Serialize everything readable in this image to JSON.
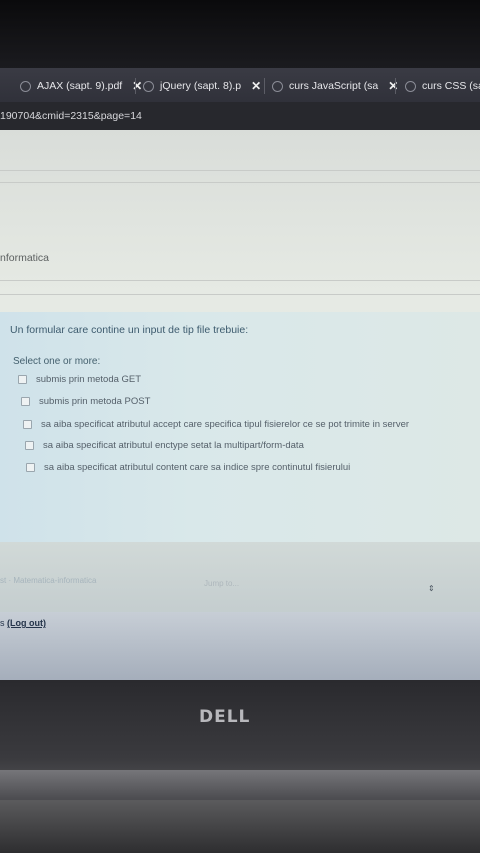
{
  "browser": {
    "tabs": [
      {
        "label": "AJAX (sapt. 9).pdf",
        "close": "✕"
      },
      {
        "label": "jQuery (sapt. 8).p",
        "close": "✕"
      },
      {
        "label": "curs JavaScript (sa",
        "close": "✕"
      },
      {
        "label": "curs CSS (sap",
        "close": ""
      }
    ],
    "url": "190704&cmid=2315&page=14"
  },
  "course": {
    "title": "nformatica"
  },
  "question": {
    "text": "Un formular care contine un input de tip file trebuie:",
    "instruction": "Select one or more:",
    "options": [
      "submis prin metoda GET",
      "submis prin metoda POST",
      "sa aiba specificat atributul accept care specifica tipul fisierelor ce se pot trimite in server",
      "sa aiba specificat atributul enctype setat la multipart/form-data",
      "sa aiba specificat atributul content care sa indice spre continutul fisierului"
    ]
  },
  "footer": {
    "breadcrumb": "st · Matematica-informatica",
    "jump_placeholder": "Jump to...",
    "jump_arrows": "⇕"
  },
  "login": {
    "prefix": "s ",
    "logout": "(Log out)"
  },
  "laptop": {
    "brand": "DELL"
  },
  "colors": {
    "accent": "#3d5b6e",
    "question_bg": "#d9e8ea"
  }
}
